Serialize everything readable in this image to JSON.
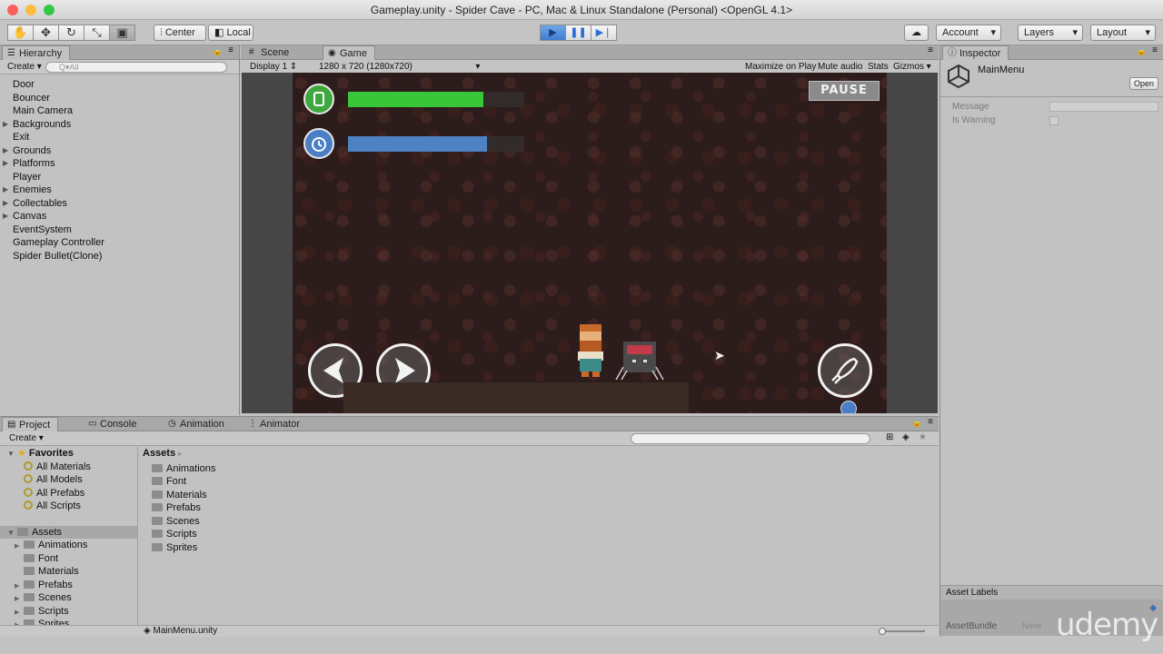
{
  "window": {
    "title": "Gameplay.unity - Spider Cave - PC, Mac & Linux Standalone (Personal) <OpenGL 4.1>"
  },
  "toolbar": {
    "tools": [
      "hand-tool",
      "move-tool",
      "rotate-tool",
      "scale-tool",
      "rect-tool"
    ],
    "pivot_label": "Center",
    "space_label": "Local",
    "account_label": "Account",
    "layers_label": "Layers",
    "layout_label": "Layout"
  },
  "hierarchy": {
    "tab_label": "Hierarchy",
    "create_label": "Create",
    "search_placeholder": "Q▾All",
    "items": [
      {
        "label": "Door",
        "expandable": false
      },
      {
        "label": "Bouncer",
        "expandable": false
      },
      {
        "label": "Main Camera",
        "expandable": false
      },
      {
        "label": "Backgrounds",
        "expandable": true
      },
      {
        "label": "Exit",
        "expandable": false
      },
      {
        "label": "Grounds",
        "expandable": true
      },
      {
        "label": "Platforms",
        "expandable": true
      },
      {
        "label": "Player",
        "expandable": false
      },
      {
        "label": "Enemies",
        "expandable": true
      },
      {
        "label": "Collectables",
        "expandable": true
      },
      {
        "label": "Canvas",
        "expandable": true
      },
      {
        "label": "EventSystem",
        "expandable": false
      },
      {
        "label": "Gameplay Controller",
        "expandable": false
      },
      {
        "label": "Spider Bullet(Clone)",
        "expandable": false
      }
    ]
  },
  "game_panel": {
    "tabs": [
      "Scene",
      "Game"
    ],
    "display": "Display 1",
    "resolution": "1280 x 720 (1280x720)",
    "options": [
      "Maximize on Play",
      "Mute audio",
      "Stats",
      "Gizmos"
    ],
    "hud": {
      "health_fill": 0.77,
      "timer_fill": 0.79,
      "pause_label": "PAUSE"
    }
  },
  "inspector": {
    "tab_label": "Inspector",
    "object_name": "MainMenu",
    "open_label": "Open",
    "fields": [
      "Message",
      "Is Warning"
    ],
    "asset_labels": "Asset Labels",
    "asset_bundle": "AssetBundle",
    "asset_bundle_value": "None"
  },
  "bottom_panel": {
    "tabs": [
      "Project",
      "Console",
      "Animation",
      "Animator"
    ],
    "create_label": "Create",
    "favorites_label": "Favorites",
    "favorites": [
      "All Materials",
      "All Models",
      "All Prefabs",
      "All Scripts"
    ],
    "assets_label": "Assets",
    "asset_tree": [
      "Animations",
      "Font",
      "Materials",
      "Prefabs",
      "Scenes",
      "Scripts",
      "Sprites"
    ],
    "breadcrumb": "Assets",
    "asset_folders": [
      "Animations",
      "Font",
      "Materials",
      "Prefabs",
      "Scenes",
      "Scripts",
      "Sprites"
    ],
    "selected_file": "MainMenu.unity"
  },
  "watermark": "udemy"
}
